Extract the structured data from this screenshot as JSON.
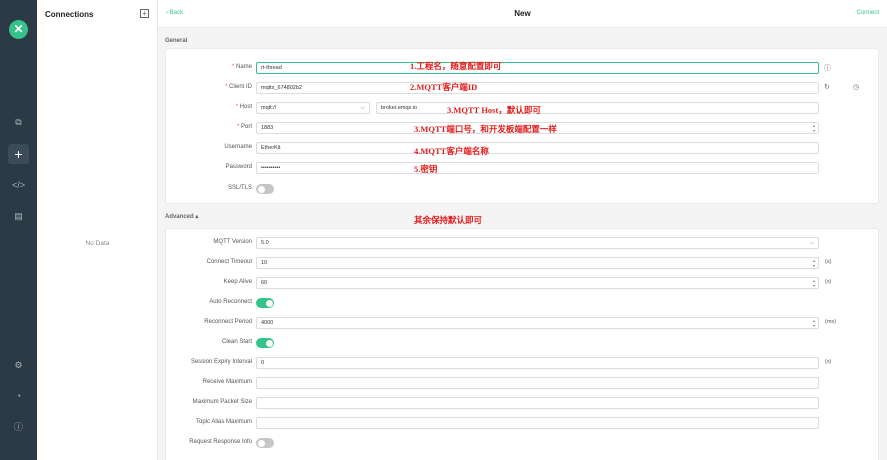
{
  "sidebar": {
    "logo": "✕",
    "icons": [
      "copy-icon",
      "plus-icon",
      "code-icon",
      "log-icon",
      "settings-icon",
      "subscribe-icon",
      "info-icon"
    ]
  },
  "connections": {
    "title": "Connections",
    "add": "+",
    "empty": "No Data"
  },
  "header": {
    "back": "‹ Back",
    "title": "New",
    "connect": "Connect"
  },
  "general": {
    "label": "General",
    "name_label": "Name",
    "name_value": "rt-thread",
    "client_id_label": "Client ID",
    "client_id_value": "mqttx_674802b2",
    "host_label": "Host",
    "protocol_value": "mqtt://",
    "host_value": "broker.emqx.io",
    "port_label": "Port",
    "port_value": "1883",
    "username_label": "Username",
    "username_value": "EtherKit",
    "password_label": "Password",
    "password_value": "••••••••••",
    "ssl_label": "SSL/TLS",
    "ssl_on": false
  },
  "advanced": {
    "label": "Advanced ▴",
    "mqtt_version_label": "MQTT Version",
    "mqtt_version_value": "5.0",
    "connect_timeout_label": "Connect Timeout",
    "connect_timeout_value": "10",
    "connect_timeout_unit": "(s)",
    "keep_alive_label": "Keep Alive",
    "keep_alive_value": "60",
    "keep_alive_unit": "(s)",
    "auto_reconnect_label": "Auto Reconnect",
    "auto_reconnect_on": true,
    "reconnect_period_label": "Reconnect Period",
    "reconnect_period_value": "4000",
    "reconnect_period_unit": "(ms)",
    "clean_start_label": "Clean Start",
    "clean_start_on": true,
    "session_expiry_label": "Session Expiry Interval",
    "session_expiry_value": "0",
    "session_expiry_unit": "(s)",
    "receive_max_label": "Receive Maximum",
    "max_packet_label": "Maximum Packet Size",
    "topic_alias_label": "Topic Alias Maximum",
    "request_response_label": "Request Response Info",
    "request_response_on": false
  },
  "annotations": {
    "a1": "1.工程名，随意配置即可",
    "a2": "2.MQTT客户端ID",
    "a3": "3.MQTT Host，默认即可",
    "a4": "3.MQTT端口号，和开发板端配置一样",
    "a5": "4.MQTT客户端名称",
    "a6": "5.密钥",
    "a7": "其余保持默认即可"
  },
  "colors": {
    "accent": "#34c388",
    "rail": "#2c3a45",
    "annotation": "#e21d1d"
  }
}
